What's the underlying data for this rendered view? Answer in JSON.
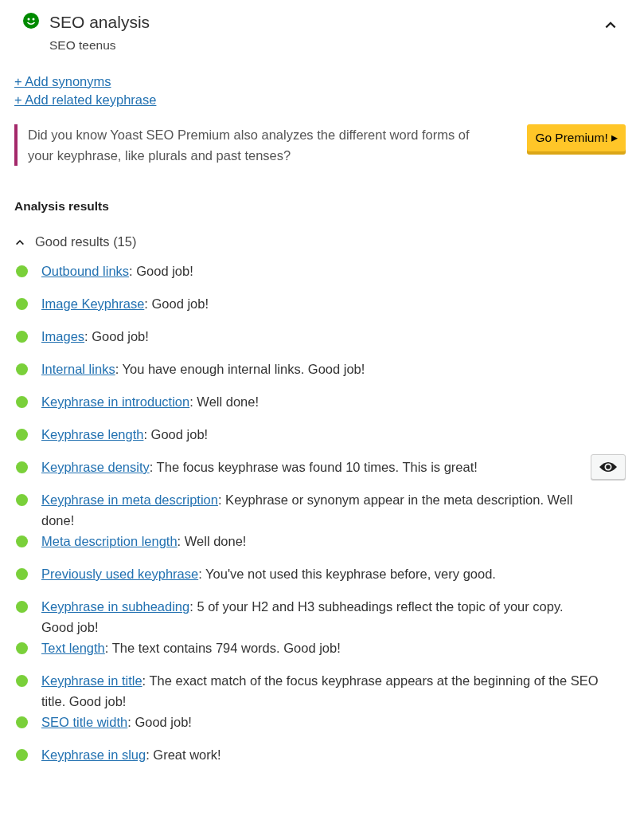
{
  "panel": {
    "title": "SEO analysis",
    "subtitle": "SEO teenus",
    "expanded": true
  },
  "links": [
    "+ Add synonyms",
    "+ Add related keyphrase"
  ],
  "upsell": {
    "text": "Did you know Yoast SEO Premium also analyzes the different word forms of your keyphrase, like plurals and past tenses?",
    "button": "Go Premium! ▸"
  },
  "results_heading": "Analysis results",
  "good_results": {
    "label": "Good results (15)",
    "expanded": true,
    "items": [
      {
        "link": "Outbound links",
        "text": ": Good job!",
        "color": "#7ad03a",
        "eye_button": false
      },
      {
        "link": "Image Keyphrase",
        "text": ": Good job!",
        "color": "#7ad03a",
        "eye_button": false
      },
      {
        "link": "Images",
        "text": ": Good job!",
        "color": "#7ad03a",
        "eye_button": false
      },
      {
        "link": "Internal links",
        "text": ": You have enough internal links. Good job!",
        "color": "#7ad03a",
        "eye_button": false
      },
      {
        "link": "Keyphrase in introduction",
        "text": ": Well done!",
        "color": "#7ad03a",
        "eye_button": false
      },
      {
        "link": "Keyphrase length",
        "text": ": Good job!",
        "color": "#7ad03a",
        "eye_button": false
      },
      {
        "link": "Keyphrase density",
        "text": ": The focus keyphrase was found 10 times. This is great!",
        "color": "#7ad03a",
        "eye_button": true
      },
      {
        "link": "Keyphrase in meta description",
        "text": ": Keyphrase or synonym appear in the meta description. Well done!",
        "color": "#7ad03a",
        "eye_button": false
      },
      {
        "link": "Meta description length",
        "text": ": Well done!",
        "color": "#7ad03a",
        "eye_button": false
      },
      {
        "link": "Previously used keyphrase",
        "text": ": You've not used this keyphrase before, very good.",
        "color": "#7ad03a",
        "eye_button": false
      },
      {
        "link": "Keyphrase in subheading",
        "text": ": 5 of your H2 and H3 subheadings reflect the topic of your copy. Good job!",
        "color": "#7ad03a",
        "eye_button": false
      },
      {
        "link": "Text length",
        "text": ": The text contains 794 words. Good job!",
        "color": "#7ad03a",
        "eye_button": false
      },
      {
        "link": "Keyphrase in title",
        "text": ": The exact match of the focus keyphrase appears at the beginning of the SEO title. Good job!",
        "color": "#7ad03a",
        "eye_button": false
      },
      {
        "link": "SEO title width",
        "text": ": Good job!",
        "color": "#7ad03a",
        "eye_button": false
      },
      {
        "link": "Keyphrase in slug",
        "text": ": Great work!",
        "color": "#7ad03a",
        "eye_button": false
      }
    ]
  }
}
